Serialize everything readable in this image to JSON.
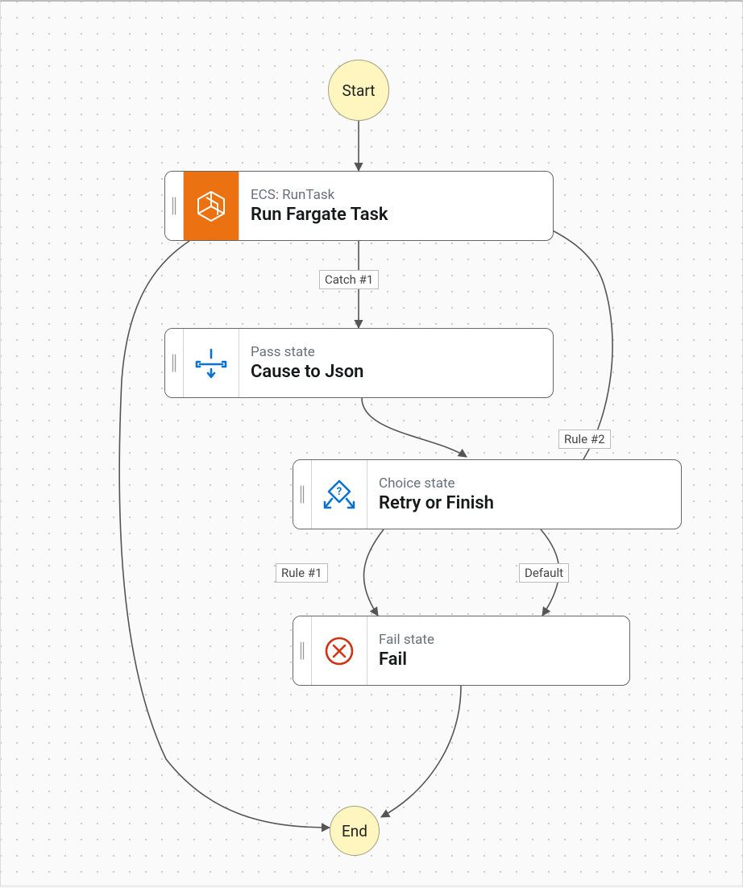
{
  "start": {
    "label": "Start"
  },
  "end": {
    "label": "End"
  },
  "states": {
    "runTask": {
      "subtitle": "ECS: RunTask",
      "title": "Run Fargate Task"
    },
    "causeToJson": {
      "subtitle": "Pass state",
      "title": "Cause to Json"
    },
    "retryOrFinish": {
      "subtitle": "Choice state",
      "title": "Retry or Finish"
    },
    "fail": {
      "subtitle": "Fail state",
      "title": "Fail"
    }
  },
  "edgeLabels": {
    "catch1": "Catch #1",
    "rule1": "Rule #1",
    "rule2": "Rule #2",
    "default_": "Default"
  }
}
